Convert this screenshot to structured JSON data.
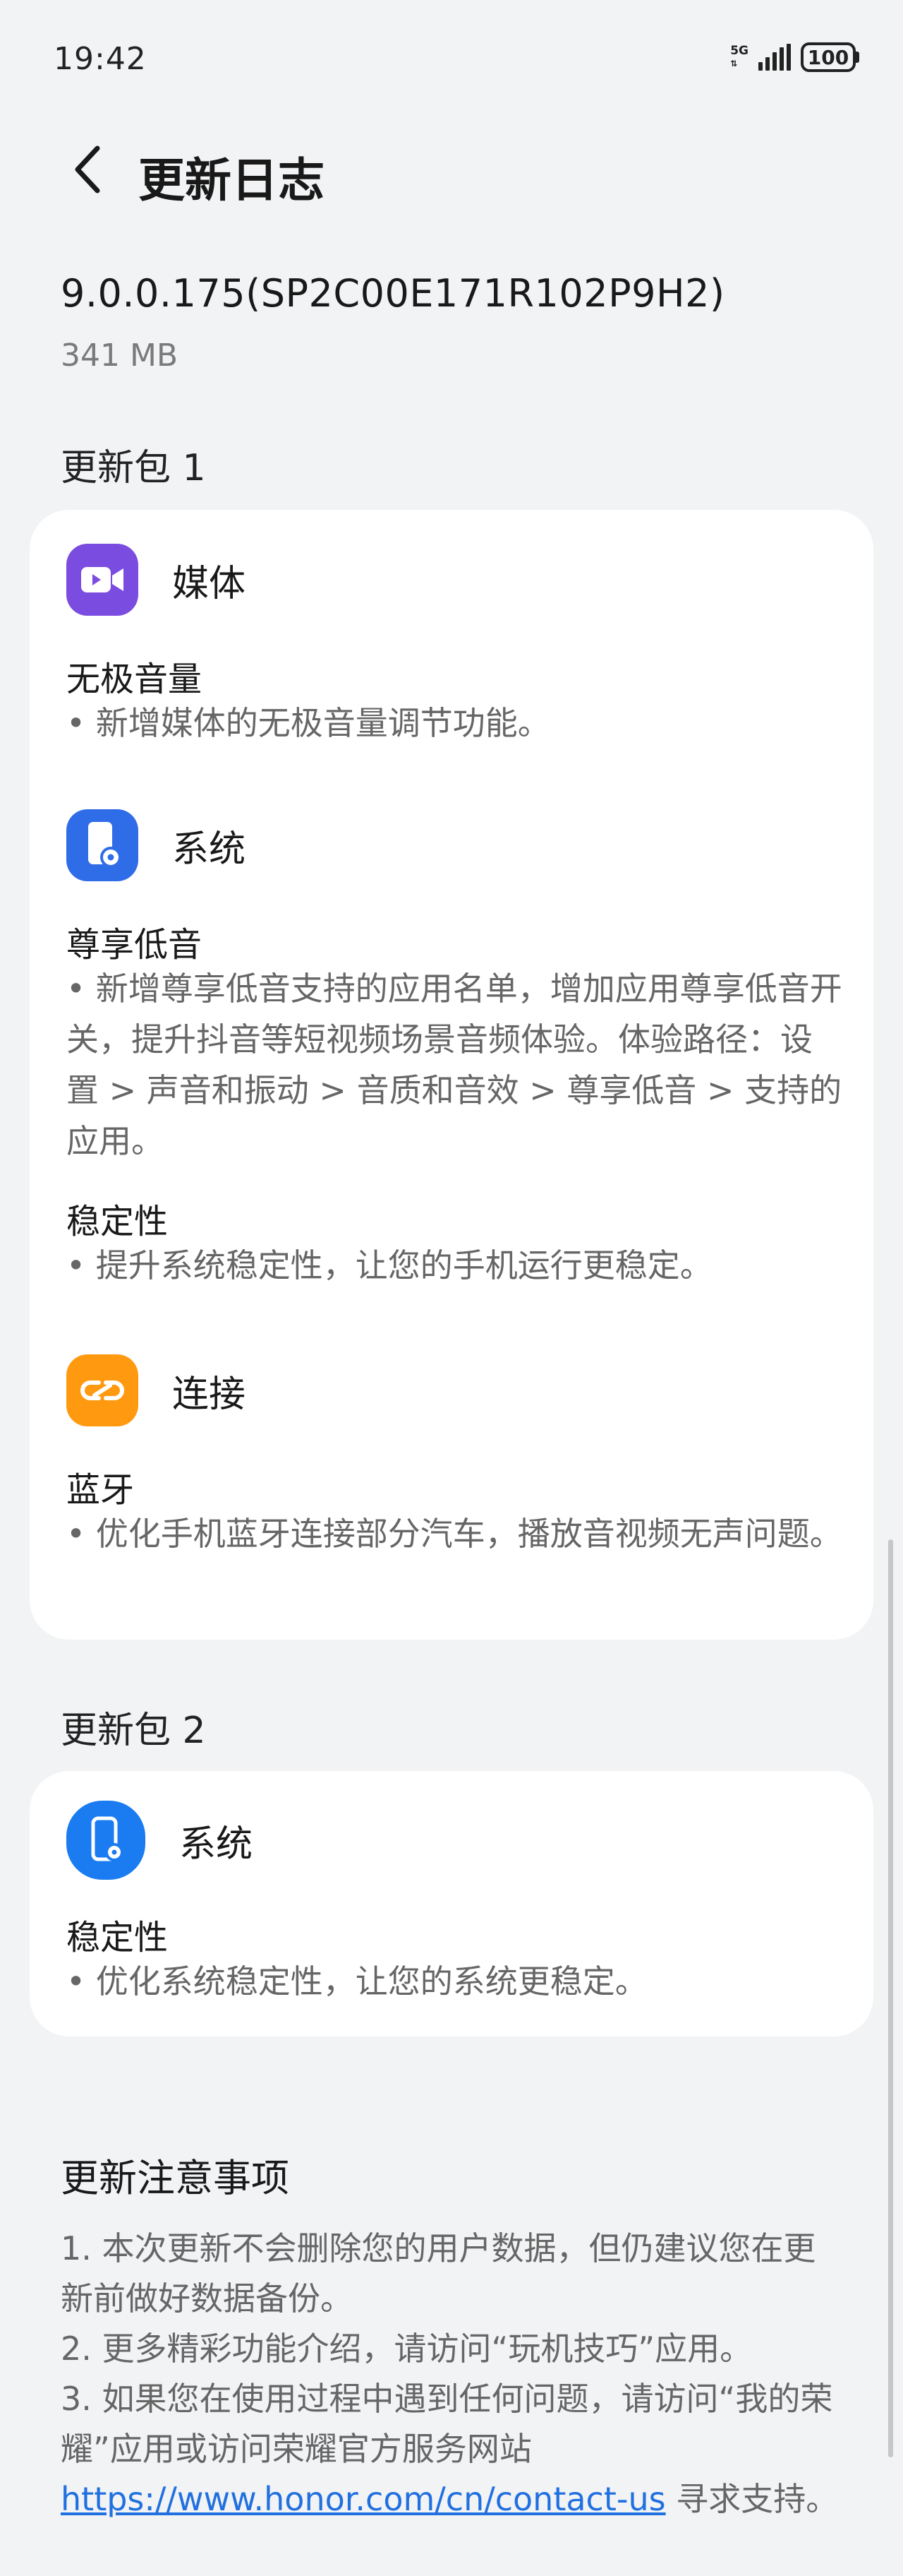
{
  "status": {
    "time": "19:42",
    "network": "5G",
    "battery": "100"
  },
  "header": {
    "title": "更新日志"
  },
  "version": {
    "name": "9.0.0.175(SP2C00E171R102P9H2)",
    "size": "341 MB"
  },
  "package1": {
    "title": "更新包 1",
    "media": {
      "label": "媒体",
      "icon": "video-camera-icon",
      "color": "#7b4ce0",
      "item_title": "无极音量",
      "item_body": "• 新增媒体的无极音量调节功能。"
    },
    "system": {
      "label": "系统",
      "icon": "phone-settings-icon",
      "color": "#2f6ce8",
      "item1_title": "尊享低音",
      "item1_body": "• 新增尊享低音支持的应用名单，增加应用尊享低音开关，提升抖音等短视频场景音频体验。体验路径：设置 > 声音和振动 > 音质和音效 > 尊享低音 > 支持的应用。",
      "item2_title": "稳定性",
      "item2_body": "• 提升系统稳定性，让您的手机运行更稳定。"
    },
    "connect": {
      "label": "连接",
      "icon": "link-icon",
      "color": "#ff9a10",
      "item_title": "蓝牙",
      "item_body": "• 优化手机蓝牙连接部分汽车，播放音视频无声问题。"
    }
  },
  "package2": {
    "title": "更新包 2",
    "system": {
      "label": "系统",
      "icon": "phone-settings-icon",
      "color": "#1a7cf0",
      "item_title": "稳定性",
      "item_body": "• 优化系统稳定性，让您的系统更稳定。"
    }
  },
  "notes": {
    "title": "更新注意事项",
    "line1": "1. 本次更新不会删除您的用户数据，但仍建议您在更新前做好数据备份。",
    "line2": "2. 更多精彩功能介绍，请访问“玩机技巧”应用。",
    "line3_prefix": "3. 如果您在使用过程中遇到任何问题，请访问“我的荣耀”应用或访问荣耀官方服务网站",
    "link": "https://www.honor.com/cn/contact-us",
    "line3_suffix": " 寻求支持。"
  }
}
